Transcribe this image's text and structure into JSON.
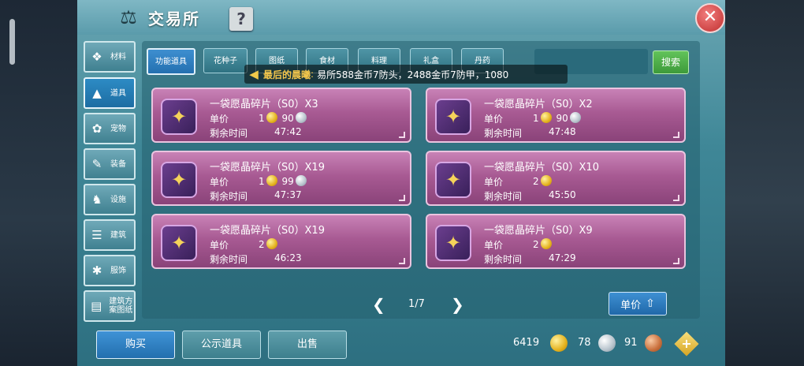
{
  "window": {
    "title": "交易所",
    "help_label": "?",
    "close_label": "✕"
  },
  "sidebar": {
    "items": [
      {
        "label": "材料",
        "icon": "materials-icon",
        "glyph": "❖"
      },
      {
        "label": "道具",
        "icon": "item-icon",
        "glyph": "▲"
      },
      {
        "label": "宠物",
        "icon": "pet-paw-icon",
        "glyph": "✿"
      },
      {
        "label": "装备",
        "icon": "equipment-icon",
        "glyph": "✎"
      },
      {
        "label": "设施",
        "icon": "facility-icon",
        "glyph": "♞"
      },
      {
        "label": "建筑",
        "icon": "building-icon",
        "glyph": "☰"
      },
      {
        "label": "服饰",
        "icon": "clothing-icon",
        "glyph": "✱"
      },
      {
        "label": "建筑方案图纸",
        "icon": "blueprint-icon",
        "glyph": "▤"
      }
    ],
    "active_index": 1
  },
  "tabs": [
    {
      "label": "功能道具"
    },
    {
      "label": "花种子"
    },
    {
      "label": "图纸"
    },
    {
      "label": "食材"
    },
    {
      "label": "料理"
    },
    {
      "label": "礼盒"
    },
    {
      "label": "丹药"
    }
  ],
  "search": {
    "value": "",
    "button_label": "搜索"
  },
  "ticker": {
    "name": "最后的晨曦",
    "separator": ":",
    "message": "易所588金币7防头，2488金币7防甲，1080"
  },
  "listing_labels": {
    "price": "单价",
    "time_left": "剩余时间"
  },
  "listings": [
    {
      "title": "一袋愿晶碎片（S0）X3",
      "price_gold": "1",
      "price_silver": "90",
      "time_left": "47:42"
    },
    {
      "title": "一袋愿晶碎片（S0）X2",
      "price_gold": "1",
      "price_silver": "90",
      "time_left": "47:48"
    },
    {
      "title": "一袋愿晶碎片（S0）X19",
      "price_gold": "1",
      "price_silver": "99",
      "time_left": "47:37"
    },
    {
      "title": "一袋愿晶碎片（S0）X10",
      "price_gold": "2",
      "price_silver": "",
      "time_left": "45:50"
    },
    {
      "title": "一袋愿晶碎片（S0）X19",
      "price_gold": "2",
      "price_silver": "",
      "time_left": "46:23"
    },
    {
      "title": "一袋愿晶碎片（S0）X9",
      "price_gold": "2",
      "price_silver": "",
      "time_left": "47:29"
    }
  ],
  "pager": {
    "prev": "❮",
    "text": "1/7",
    "next": "❯"
  },
  "sort": {
    "label": "单价",
    "arrow": "⇧"
  },
  "bottom_buttons": {
    "buy": "购买",
    "public": "公示道具",
    "sell": "出售"
  },
  "currency": {
    "gold": "6419",
    "silver": "78",
    "bronze": "91",
    "plus": "+"
  },
  "colors": {
    "card": "#a85a93",
    "accent_blue": "#2d8bc4",
    "search_green": "#4aa843",
    "gold_text": "#f3c64b"
  }
}
